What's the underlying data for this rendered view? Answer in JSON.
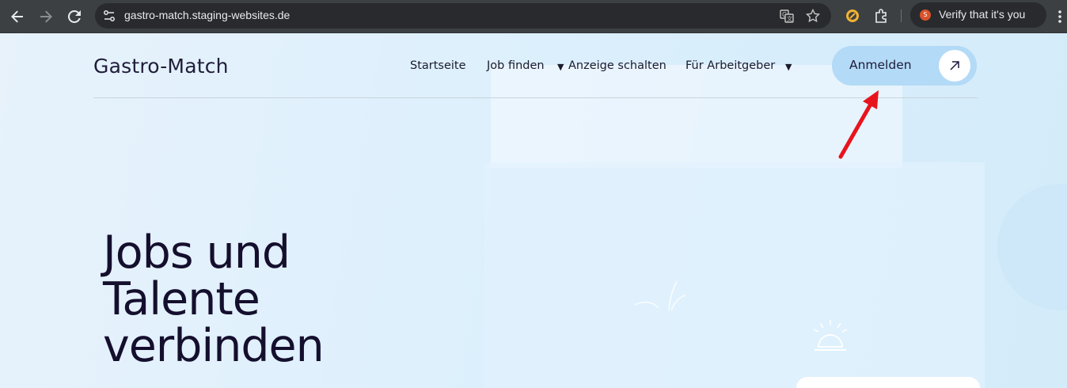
{
  "browser": {
    "url": "gastro-match.staging-websites.de",
    "profile_pill": "Verify that it's you",
    "profile_initial": "S",
    "icons": {
      "back": "back-arrow-icon",
      "forward": "forward-arrow-icon",
      "reload": "reload-icon",
      "site_info": "site-settings-icon",
      "translate": "translate-icon",
      "bookmark": "star-icon",
      "extension1": "extension-badge-icon",
      "extensions": "puzzle-icon",
      "menu": "more-vert-icon"
    }
  },
  "header": {
    "logo": "Gastro-Match",
    "nav": {
      "home": "Startseite",
      "jobs": "Job finden",
      "post_ad": "Anzeige schalten",
      "employers": "Für Arbeitgeber"
    },
    "login": "Anmelden"
  },
  "hero": {
    "title_lines": [
      "Jobs und",
      "Talente",
      "verbinden"
    ]
  },
  "colors": {
    "login_bg": "#b3daf6",
    "title": "#150f2e",
    "annotation_arrow": "#e8141d"
  }
}
